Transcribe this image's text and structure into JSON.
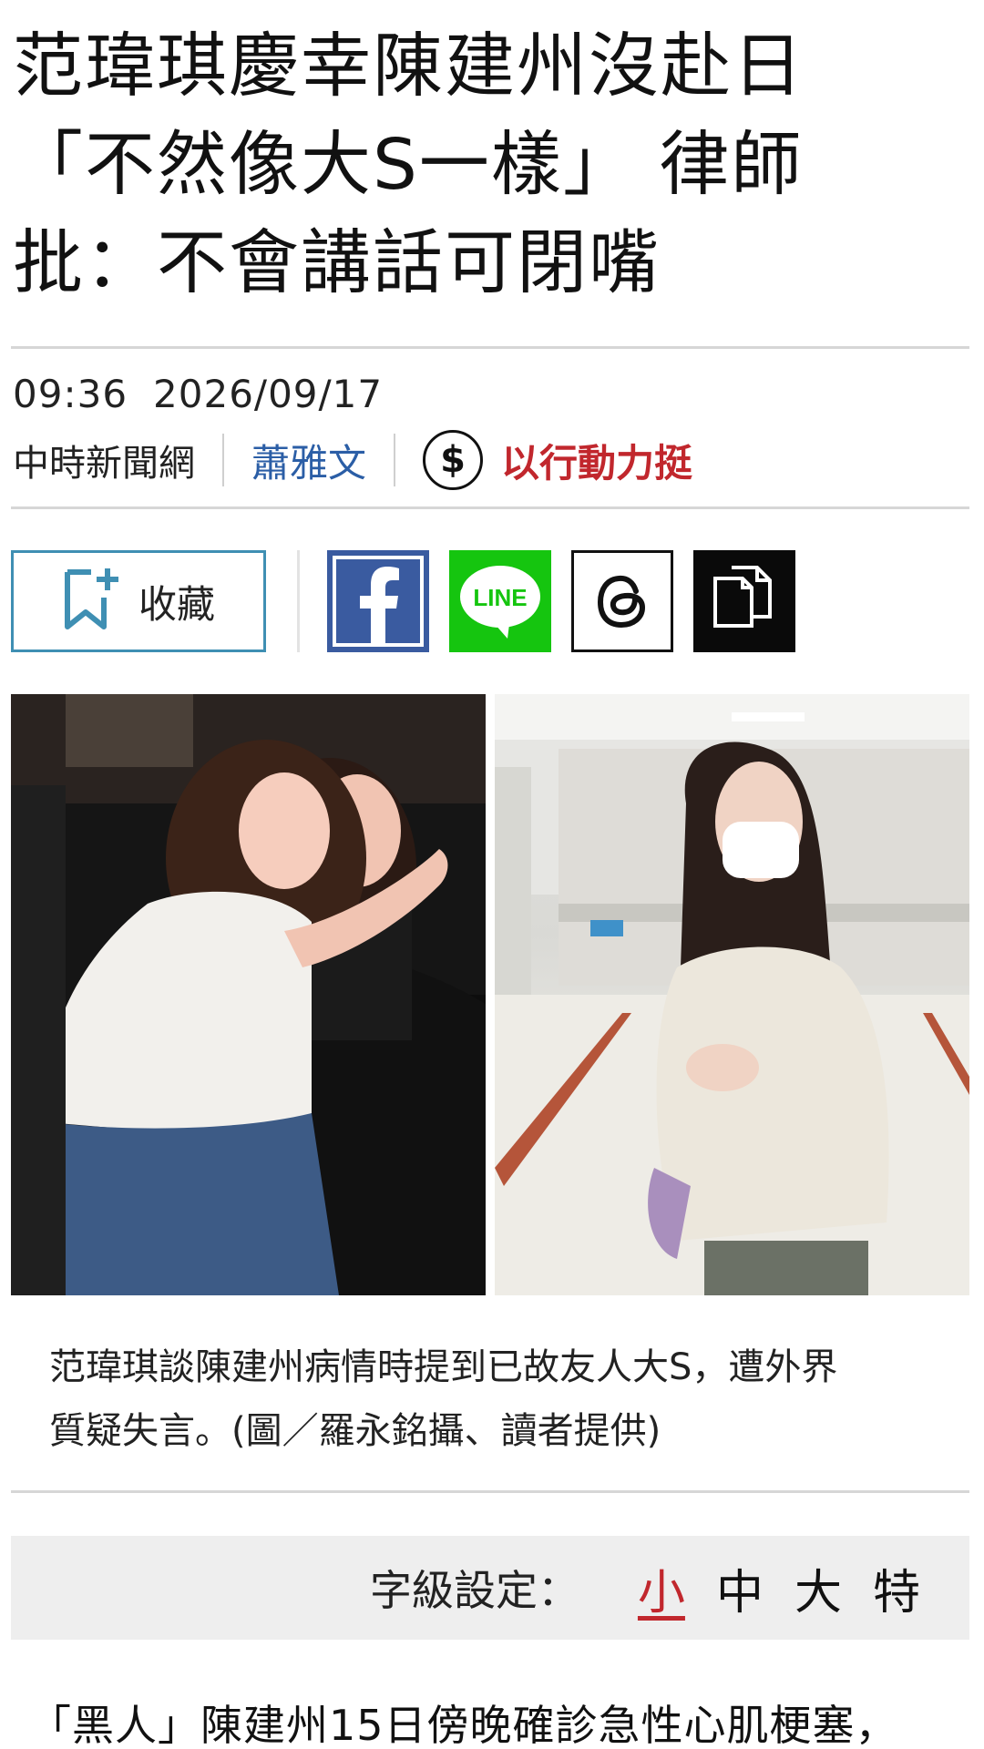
{
  "headline": {
    "line1": "范瑋琪慶幸陳建州沒赴日",
    "line2": "「不然像大S一樣」 律師",
    "line3": "批：不會講話可閉嘴"
  },
  "meta": {
    "time": "09:36",
    "date": "2026/09/17",
    "source": "中時新聞網",
    "author": "蕭雅文",
    "support_icon": "$",
    "support_label": "以行動力挺"
  },
  "actions": {
    "save_label": "收藏",
    "share_icons": [
      "facebook-icon",
      "line-icon",
      "threads-icon",
      "copy-link-icon"
    ],
    "line_text": "LINE"
  },
  "caption": {
    "line1": "范瑋琪談陳建州病情時提到已故友人大S，遭外界",
    "line2": "質疑失言。(圖／羅永銘攝、讀者提供)"
  },
  "font_size": {
    "label": "字級設定：",
    "options": [
      "小",
      "中",
      "大",
      "特"
    ],
    "selected": "小"
  },
  "body": {
    "first_line": "「黑人」陳建州15日傍晚確診急性心肌梗塞，"
  },
  "colors": {
    "accent_red": "#c1272d",
    "author_blue": "#2b5ea6",
    "facebook": "#3a5ba0",
    "line": "#15c50f",
    "save_border": "#3f8fb3"
  }
}
